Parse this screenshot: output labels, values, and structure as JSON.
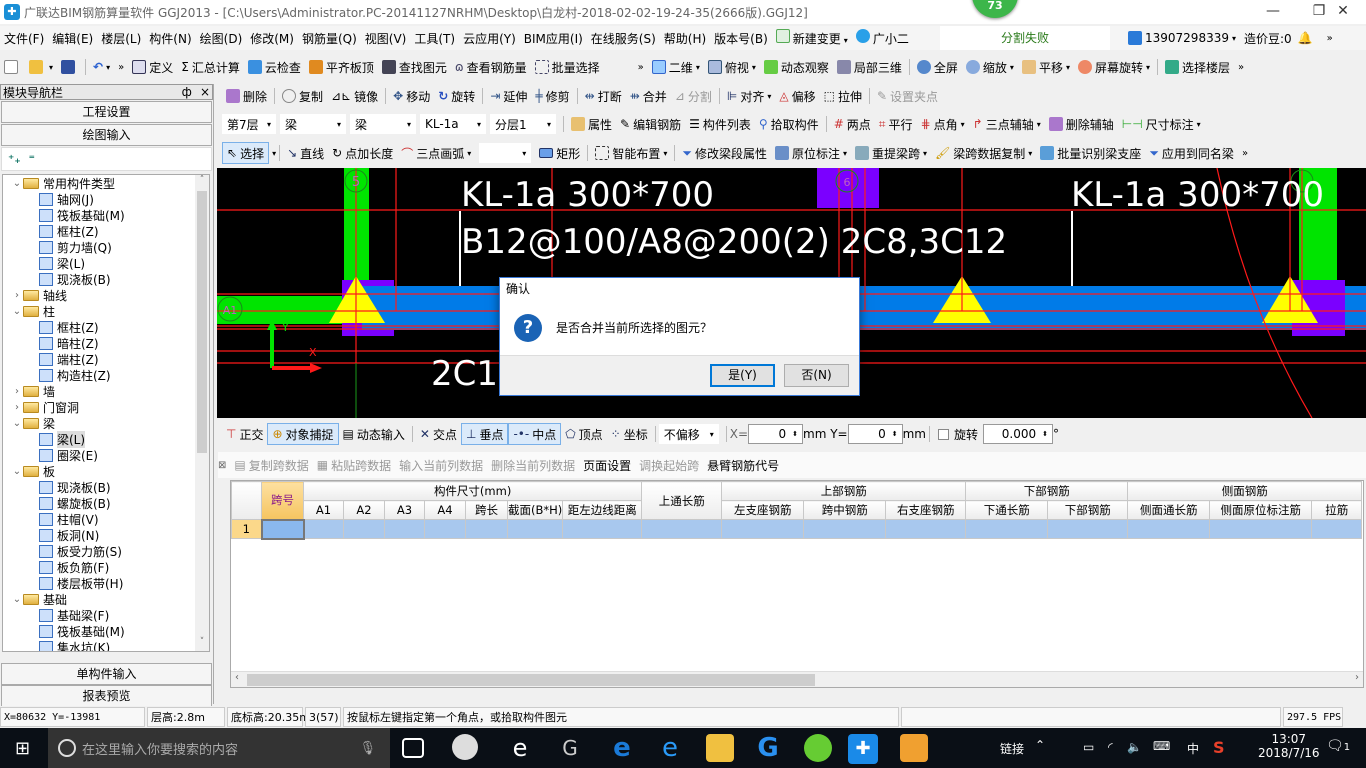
{
  "window": {
    "title": "广联达BIM钢筋算量软件 GGJ2013 - [C:\\Users\\Administrator.PC-20141127NRHM\\Desktop\\白龙村-2018-02-02-19-24-35(2666版).GGJ12]",
    "notification_badge": "73",
    "minimize": "—",
    "restore": "❐",
    "close": "✕"
  },
  "menu": {
    "items": [
      "文件(F)",
      "编辑(E)",
      "楼层(L)",
      "构件(N)",
      "绘图(D)",
      "修改(M)",
      "钢筋量(Q)",
      "视图(V)",
      "工具(T)",
      "云应用(Y)",
      "BIM应用(I)",
      "在线服务(S)",
      "帮助(H)",
      "版本号(B)"
    ],
    "new_change": "新建变更",
    "assistant": "广小二",
    "status_message": "分割失败",
    "account": "13907298339",
    "price_beans": "造价豆:0"
  },
  "toolbar1": {
    "items": [
      "定义",
      "汇总计算",
      "云检查",
      "平齐板顶",
      "查找图元",
      "查看钢筋量",
      "批量选择"
    ],
    "view_items": [
      "二维",
      "俯视",
      "动态观察",
      "局部三维",
      "全屏",
      "缩放",
      "平移",
      "屏幕旋转",
      "选择楼层"
    ]
  },
  "toolbar2": {
    "items": [
      "删除",
      "复制",
      "镜像",
      "移动",
      "旋转",
      "延伸",
      "修剪",
      "打断",
      "合并",
      "分割",
      "对齐",
      "偏移",
      "拉伸",
      "设置夹点"
    ],
    "disabled": [
      "分割",
      "设置夹点"
    ]
  },
  "toolbar3": {
    "floor": "第7层",
    "type1": "梁",
    "type2": "梁",
    "component": "KL-1a",
    "layer": "分层1",
    "items": [
      "属性",
      "编辑钢筋",
      "构件列表",
      "拾取构件",
      "两点",
      "平行",
      "点角",
      "三点辅轴",
      "删除辅轴",
      "尺寸标注"
    ]
  },
  "toolbar4": {
    "items": [
      "选择",
      "直线",
      "点加长度",
      "三点画弧",
      "矩形",
      "智能布置",
      "修改梁段属性",
      "原位标注",
      "重提梁跨",
      "梁跨数据复制",
      "批量识别梁支座",
      "应用到同名梁"
    ]
  },
  "nav": {
    "title": "模块导航栏",
    "pin": "ф",
    "close": "×",
    "buttons_top": [
      "工程设置",
      "绘图输入"
    ],
    "buttons_bottom": [
      "单构件输入",
      "报表预览"
    ],
    "tree": [
      {
        "label": "常用构件类型",
        "level": 0,
        "expanded": true
      },
      {
        "label": "轴网(J)",
        "level": 1
      },
      {
        "label": "筏板基础(M)",
        "level": 1
      },
      {
        "label": "框柱(Z)",
        "level": 1
      },
      {
        "label": "剪力墙(Q)",
        "level": 1
      },
      {
        "label": "梁(L)",
        "level": 1
      },
      {
        "label": "现浇板(B)",
        "level": 1
      },
      {
        "label": "轴线",
        "level": 0,
        "expanded": false
      },
      {
        "label": "柱",
        "level": 0,
        "expanded": true
      },
      {
        "label": "框柱(Z)",
        "level": 1
      },
      {
        "label": "暗柱(Z)",
        "level": 1
      },
      {
        "label": "端柱(Z)",
        "level": 1
      },
      {
        "label": "构造柱(Z)",
        "level": 1
      },
      {
        "label": "墙",
        "level": 0,
        "expanded": false
      },
      {
        "label": "门窗洞",
        "level": 0,
        "expanded": false
      },
      {
        "label": "梁",
        "level": 0,
        "expanded": true
      },
      {
        "label": "梁(L)",
        "level": 1,
        "selected": true
      },
      {
        "label": "圈梁(E)",
        "level": 1
      },
      {
        "label": "板",
        "level": 0,
        "expanded": true
      },
      {
        "label": "现浇板(B)",
        "level": 1
      },
      {
        "label": "螺旋板(B)",
        "level": 1
      },
      {
        "label": "柱帽(V)",
        "level": 1
      },
      {
        "label": "板洞(N)",
        "level": 1
      },
      {
        "label": "板受力筋(S)",
        "level": 1
      },
      {
        "label": "板负筋(F)",
        "level": 1
      },
      {
        "label": "楼层板带(H)",
        "level": 1
      },
      {
        "label": "基础",
        "level": 0,
        "expanded": true
      },
      {
        "label": "基础梁(F)",
        "level": 1
      },
      {
        "label": "筏板基础(M)",
        "level": 1
      },
      {
        "label": "集水坑(K)",
        "level": 1
      }
    ]
  },
  "canvas": {
    "beam_label_1": "KL-1a 300*700",
    "beam_rebar_1": "B12@100/A8@200(2) 2C8,3C12",
    "beam_label_2": "KL-1a 300*700",
    "beam_label_3": "KL-1a 300*700",
    "axis_5": "5",
    "axis_6": "6",
    "axis_7": "7",
    "axis_a1": "A1",
    "bottom_text": "2C1",
    "ucs_x": "X",
    "ucs_y": "Y"
  },
  "dialog": {
    "title": "确认",
    "message": "是否合并当前所选择的图元？",
    "yes": "是(Y)",
    "no": "否(N)"
  },
  "snapbar": {
    "items": [
      "正交",
      "对象捕捉",
      "动态输入",
      "交点",
      "垂点",
      "中点",
      "顶点",
      "坐标"
    ],
    "active": [
      "对象捕捉",
      "垂点",
      "中点"
    ],
    "offset_mode": "不偏移",
    "x_label": "X=",
    "x_value": "0",
    "y_label": "mm Y=",
    "y_value": "0",
    "unit": "mm",
    "rotate_label": "旋转",
    "rotate_value": "0.000",
    "degree": "°"
  },
  "span_toolbar": {
    "items": [
      "复制跨数据",
      "粘贴跨数据",
      "输入当前列数据",
      "删除当前列数据",
      "页面设置",
      "调换起始跨",
      "悬臂钢筋代号"
    ],
    "enabled": [
      "页面设置",
      "悬臂钢筋代号"
    ]
  },
  "span_table": {
    "group_headers": [
      {
        "label": "跨号",
        "span": 1
      },
      {
        "label": "构件尺寸(mm)",
        "span": 7
      },
      {
        "label": "上通长筋",
        "span": 1
      },
      {
        "label": "上部钢筋",
        "span": 3
      },
      {
        "label": "下部钢筋",
        "span": 2
      },
      {
        "label": "侧面钢筋",
        "span": 3
      }
    ],
    "sub_headers": [
      "A1",
      "A2",
      "A3",
      "A4",
      "跨长",
      "截面(B*H)",
      "距左边线距离",
      "左支座钢筋",
      "跨中钢筋",
      "右支座钢筋",
      "下通长筋",
      "下部钢筋",
      "侧面通长筋",
      "侧面原位标注筋",
      "拉筋"
    ],
    "rows": [
      {
        "index": "1",
        "cells": [
          "",
          "",
          "",
          "",
          "",
          "",
          "",
          "",
          "",
          "",
          "",
          "",
          "",
          "",
          "",
          "",
          ""
        ]
      }
    ]
  },
  "statusbar": {
    "coords": "X=80632 Y=-13981",
    "floor_height": "层高:2.8m",
    "base_elev": "底标高:20.35m",
    "count": "3(57)",
    "hint": "按鼠标左键指定第一个角点，或拾取构件图元",
    "fps": "297.5 FPS"
  },
  "taskbar": {
    "search_placeholder": "在这里输入你要搜索的内容",
    "link_label": "链接",
    "ime": "中",
    "time": "13:07",
    "date": "2018/7/16",
    "notifications": "1"
  }
}
